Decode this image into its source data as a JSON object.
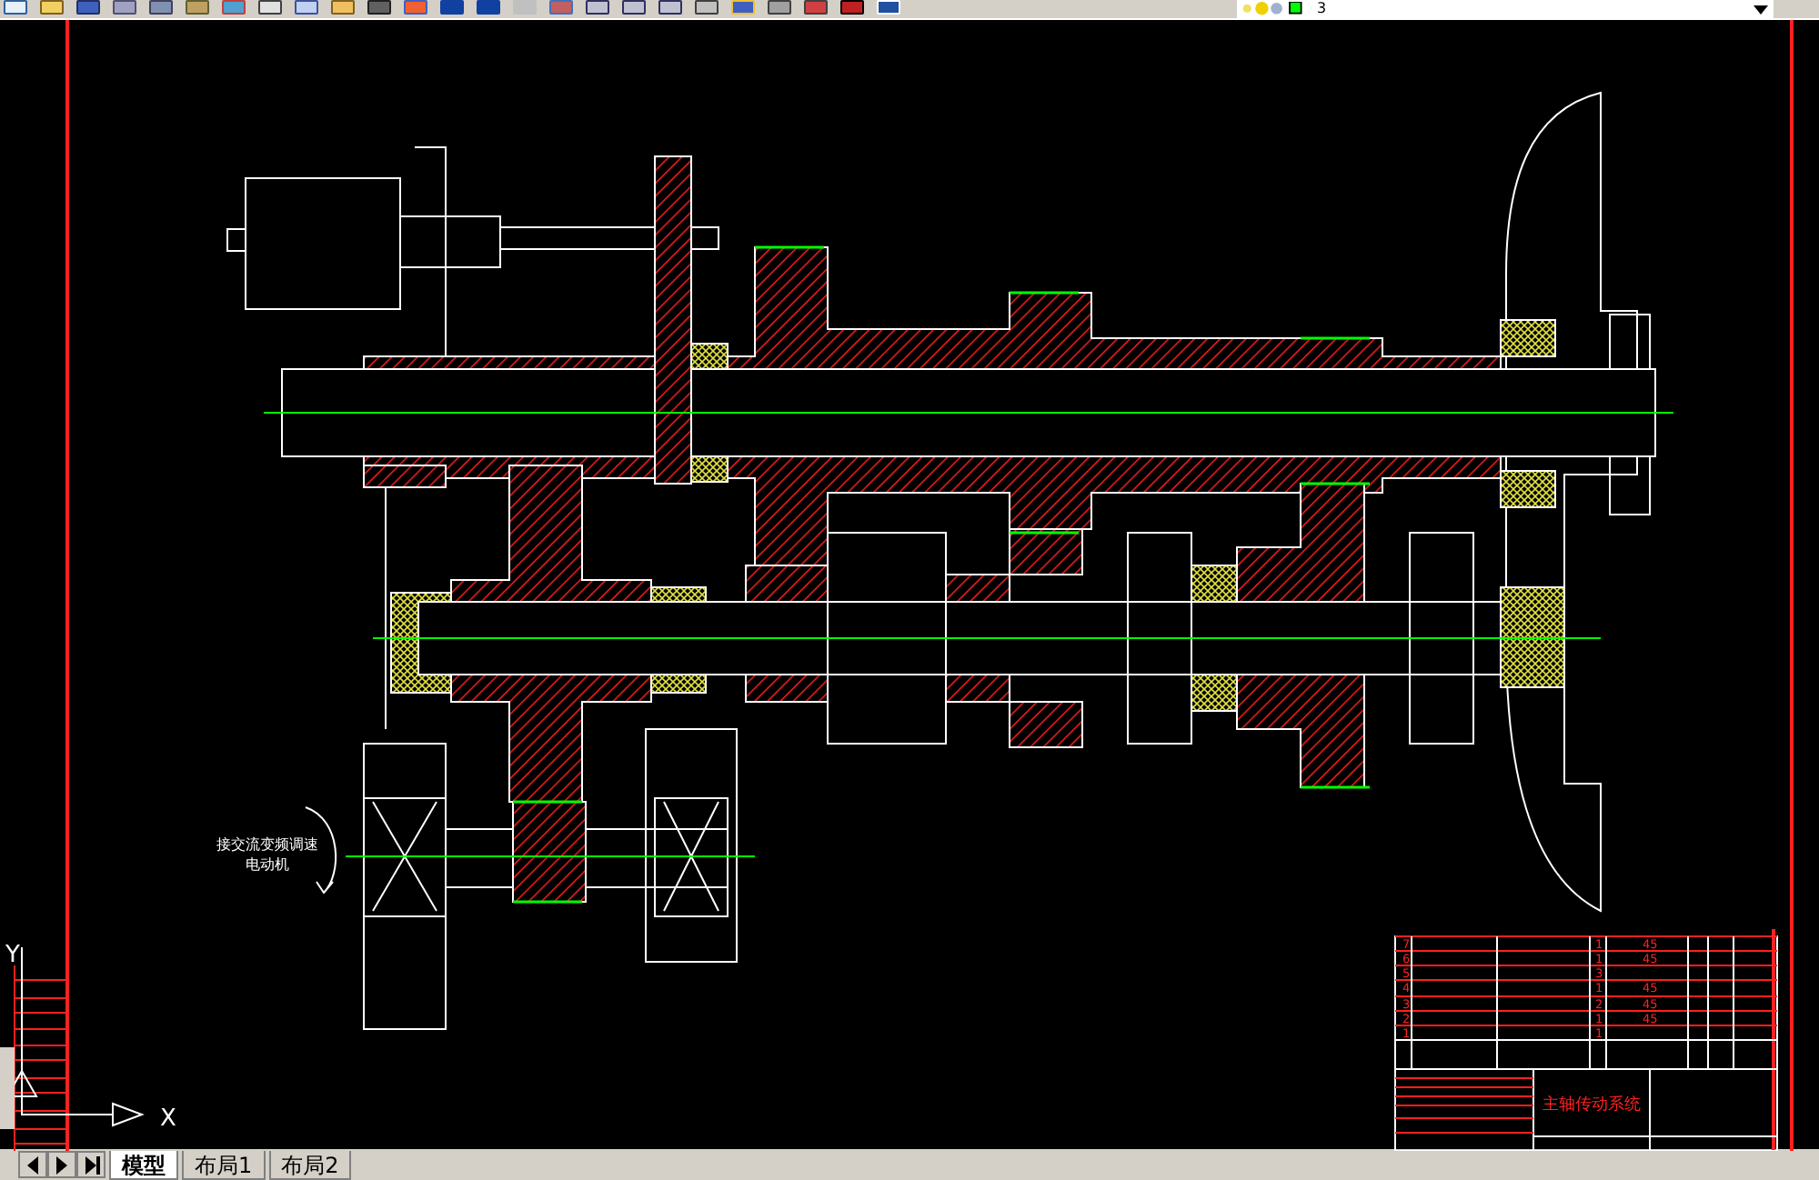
{
  "toolbar": {
    "layer": "3"
  },
  "drawing": {
    "note_lines": [
      "接交流变频调速",
      "电动机"
    ],
    "ucs": {
      "x_label": "X",
      "y_label": "Y"
    }
  },
  "title_block": {
    "parts": [
      {
        "no": "7",
        "qty": "1",
        "material": "45"
      },
      {
        "no": "6",
        "qty": "1",
        "material": "45"
      },
      {
        "no": "5",
        "qty": "3"
      },
      {
        "no": "4",
        "qty": "1",
        "material": "45"
      },
      {
        "no": "3",
        "qty": "2",
        "material": "45"
      },
      {
        "no": "2",
        "qty": "1",
        "material": "45"
      },
      {
        "no": "1",
        "qty": "1"
      }
    ],
    "title": "主轴传动系统"
  },
  "tabs": [
    {
      "label": "模型",
      "selected": true
    },
    {
      "label": "布局1",
      "selected": false
    },
    {
      "label": "布局2",
      "selected": false
    }
  ]
}
